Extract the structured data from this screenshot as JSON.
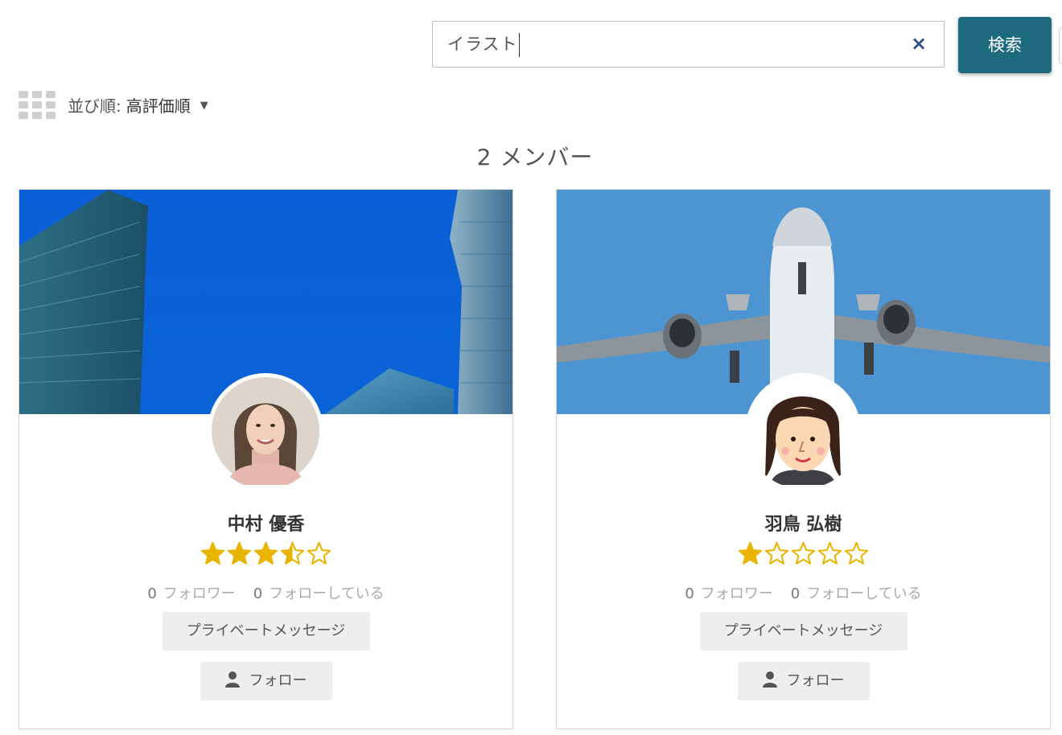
{
  "search": {
    "value": "イラスト",
    "clear_symbol": "×",
    "button_label": "検索"
  },
  "sort": {
    "label": "並び順:",
    "value": "高評価順"
  },
  "results": {
    "count_text": "2 メンバー"
  },
  "members": [
    {
      "name": "中村 優香",
      "rating": 3.5,
      "followers_count": "0",
      "followers_label": "フォロワー",
      "following_count": "0",
      "following_label": "フォローしている",
      "message_label": "プライベートメッセージ",
      "follow_label": "フォロー"
    },
    {
      "name": "羽鳥 弘樹",
      "rating": 1,
      "followers_count": "0",
      "followers_label": "フォロワー",
      "following_count": "0",
      "following_label": "フォローしている",
      "message_label": "プライベートメッセージ",
      "follow_label": "フォロー"
    }
  ],
  "colors": {
    "accent": "#1e6a7f",
    "star": "#e8b400",
    "clear_icon": "#2d4f8a"
  },
  "icons": {
    "view": "grid-view-icon",
    "sort": "caret-down-icon",
    "clear": "close-icon",
    "follow": "user-icon"
  }
}
